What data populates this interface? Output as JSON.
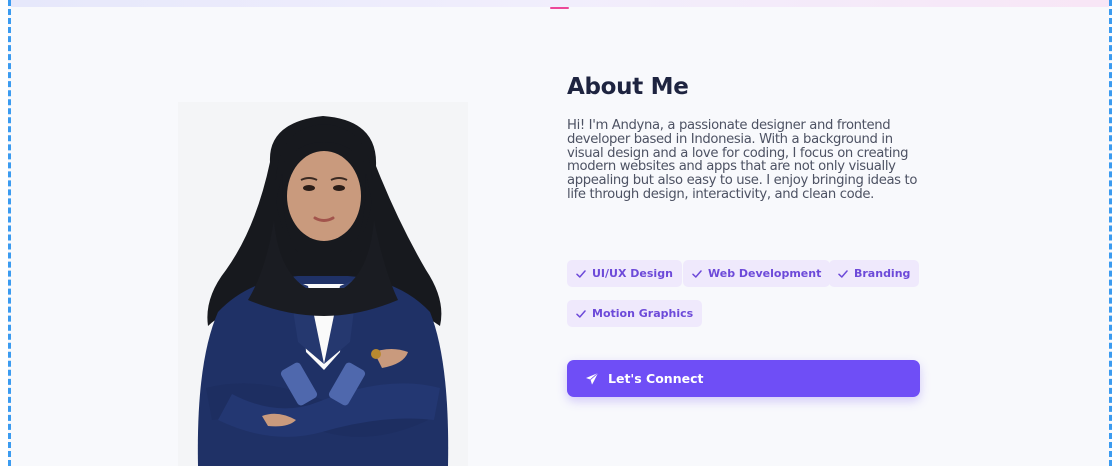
{
  "about": {
    "title": "About Me",
    "description": "Hi! I'm Andyna, a passionate designer and frontend developer based in Indonesia. With a background in visual design and a love for coding, I focus on creating modern websites and apps that are not only visually appealing but also easy to use. I enjoy bringing ideas to life through design, interactivity, and clean code."
  },
  "skills": [
    {
      "label": "UI/UX Design",
      "icon": "check-icon"
    },
    {
      "label": "Web Development",
      "icon": "check-icon"
    },
    {
      "label": "Branding",
      "icon": "check-icon"
    },
    {
      "label": "Motion Graphics",
      "icon": "check-icon"
    }
  ],
  "cta": {
    "label": "Let's Connect",
    "icon": "paper-plane-icon"
  },
  "colors": {
    "accent": "#6f4ef6",
    "tag_bg": "#efe9fc",
    "tag_text": "#6d4ad9",
    "heading": "#1e2440",
    "body_text": "#4d5263",
    "section_bg": "#f8f9fc",
    "frame_border": "#3b9bf0",
    "top_accent": "#ec4899"
  }
}
